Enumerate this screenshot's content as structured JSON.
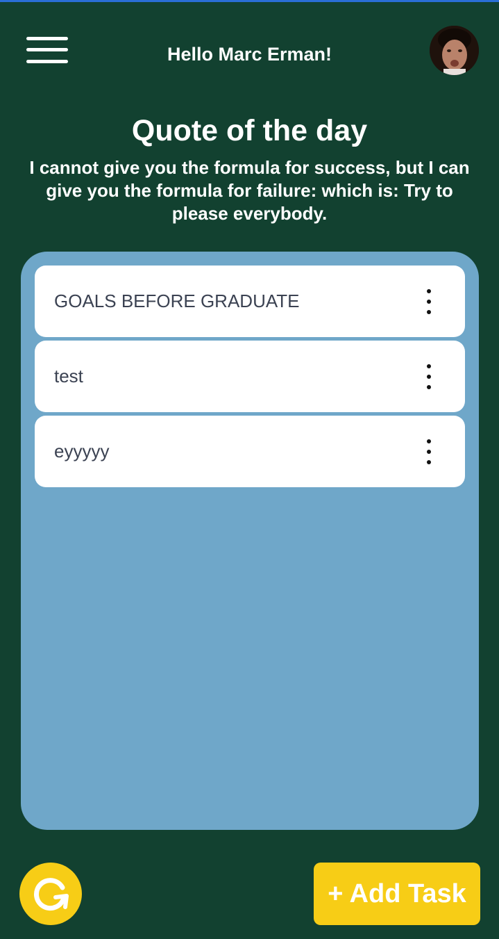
{
  "header": {
    "greeting": "Hello Marc Erman!",
    "menu_icon": "hamburger-menu-icon",
    "avatar_icon": "user-avatar"
  },
  "quote": {
    "title": "Quote of the day",
    "text": "I cannot give you the formula for success, but I can give you the formula for failure: which is: Try to please everybody."
  },
  "tasks": [
    {
      "title": "GOALS BEFORE GRADUATE",
      "menu_icon": "more-vertical-icon"
    },
    {
      "title": "test",
      "menu_icon": "more-vertical-icon"
    },
    {
      "title": "eyyyyy",
      "menu_icon": "more-vertical-icon"
    }
  ],
  "footer": {
    "refresh_icon": "refresh-icon",
    "add_task_label": "+ Add Task"
  },
  "colors": {
    "background": "#124130",
    "panel": "#6fa7c9",
    "card": "#ffffff",
    "accent": "#f7cd16",
    "text_light": "#ffffff",
    "text_dark": "#3b4252"
  }
}
